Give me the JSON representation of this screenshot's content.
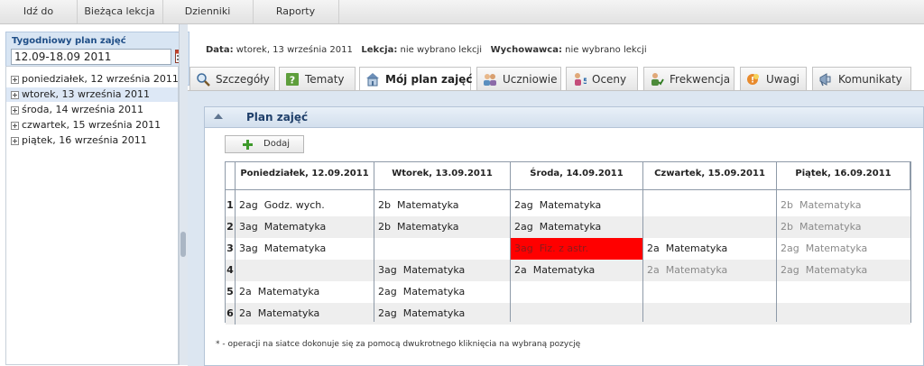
{
  "menu": {
    "items": [
      {
        "label": "Idź do"
      },
      {
        "label": "Bieżąca lekcja"
      },
      {
        "label": "Dzienniki"
      },
      {
        "label": "Raporty"
      }
    ]
  },
  "sidebar": {
    "week_label": "Tygodniowy plan zajęć",
    "week_value": "12.09-18.09 2011",
    "days": [
      {
        "label": "poniedziałek, 12 września 2011",
        "selected": false
      },
      {
        "label": "wtorek, 13 września 2011",
        "selected": true
      },
      {
        "label": "środa, 14 września 2011",
        "selected": false
      },
      {
        "label": "czwartek, 15 września 2011",
        "selected": false
      },
      {
        "label": "piątek, 16 września 2011",
        "selected": false
      }
    ]
  },
  "info": {
    "date_label": "Data:",
    "date_value": "wtorek, 13 września 2011",
    "lesson_label": "Lekcja:",
    "lesson_value": "nie wybrano lekcji",
    "tutor_label": "Wychowawca:",
    "tutor_value": "nie wybrano lekcji"
  },
  "tabs": [
    {
      "label": "Szczegóły",
      "icon": "magnifier-icon"
    },
    {
      "label": "Tematy",
      "icon": "question-book-icon"
    },
    {
      "label": "Mój plan zajęć",
      "icon": "building-icon",
      "active": true
    },
    {
      "label": "Uczniowie",
      "icon": "students-icon"
    },
    {
      "label": "Oceny",
      "icon": "grades-icon"
    },
    {
      "label": "Frekwencja",
      "icon": "attendance-icon"
    },
    {
      "label": "Uwagi",
      "icon": "remarks-icon"
    },
    {
      "label": "Komunikaty",
      "icon": "megaphone-icon"
    }
  ],
  "panel": {
    "title": "Plan zajęć",
    "add_label": "Dodaj",
    "footnote": "* - operacji na siatce dokonuje się za pomocą dwukrotnego kliknięcia na wybraną pozycję"
  },
  "schedule": {
    "days": [
      "Poniedziałek, 12.09.2011",
      "Wtorek, 13.09.2011",
      "Środa, 14.09.2011",
      "Czwartek, 15.09.2011",
      "Piątek, 16.09.2011"
    ],
    "rows": [
      {
        "num": "1",
        "cells": [
          {
            "cls": "2ag",
            "subj": "Godz. wych.",
            "state": "normal"
          },
          {
            "cls": "2b",
            "subj": "Matematyka",
            "state": "normal"
          },
          {
            "cls": "2ag",
            "subj": "Matematyka",
            "state": "normal"
          },
          {
            "cls": "",
            "subj": "",
            "state": "normal"
          },
          {
            "cls": "2b",
            "subj": "Matematyka",
            "state": "gray"
          }
        ]
      },
      {
        "num": "2",
        "cells": [
          {
            "cls": "3ag",
            "subj": "Matematyka",
            "state": "normal"
          },
          {
            "cls": "2b",
            "subj": "Matematyka",
            "state": "normal"
          },
          {
            "cls": "2ag",
            "subj": "Matematyka",
            "state": "normal"
          },
          {
            "cls": "",
            "subj": "",
            "state": "normal"
          },
          {
            "cls": "2b",
            "subj": "Matematyka",
            "state": "gray"
          }
        ]
      },
      {
        "num": "3",
        "cells": [
          {
            "cls": "3ag",
            "subj": "Matematyka",
            "state": "normal"
          },
          {
            "cls": "",
            "subj": "",
            "state": "normal"
          },
          {
            "cls": "3ag",
            "subj": "Fiz. z astr.",
            "state": "red"
          },
          {
            "cls": "2a",
            "subj": "Matematyka",
            "state": "normal"
          },
          {
            "cls": "2ag",
            "subj": "Matematyka",
            "state": "gray"
          }
        ]
      },
      {
        "num": "4",
        "cells": [
          {
            "cls": "",
            "subj": "",
            "state": "normal"
          },
          {
            "cls": "3ag",
            "subj": "Matematyka",
            "state": "normal"
          },
          {
            "cls": "2a",
            "subj": "Matematyka",
            "state": "normal"
          },
          {
            "cls": "2a",
            "subj": "Matematyka",
            "state": "gray"
          },
          {
            "cls": "2ag",
            "subj": "Matematyka",
            "state": "gray"
          }
        ]
      },
      {
        "num": "5",
        "cells": [
          {
            "cls": "2a",
            "subj": "Matematyka",
            "state": "normal"
          },
          {
            "cls": "2ag",
            "subj": "Matematyka",
            "state": "normal"
          },
          {
            "cls": "",
            "subj": "",
            "state": "normal"
          },
          {
            "cls": "",
            "subj": "",
            "state": "normal"
          },
          {
            "cls": "",
            "subj": "",
            "state": "normal"
          }
        ]
      },
      {
        "num": "6",
        "cells": [
          {
            "cls": "2a",
            "subj": "Matematyka",
            "state": "normal"
          },
          {
            "cls": "2ag",
            "subj": "Matematyka",
            "state": "normal"
          },
          {
            "cls": "",
            "subj": "",
            "state": "normal"
          },
          {
            "cls": "",
            "subj": "",
            "state": "normal"
          },
          {
            "cls": "",
            "subj": "",
            "state": "normal"
          }
        ]
      }
    ]
  },
  "colors": {
    "accent": "#1f4e87",
    "highlight_red": "#ff0000",
    "row_alt": "#eeeeee",
    "gray_text": "#8a8a8a"
  }
}
